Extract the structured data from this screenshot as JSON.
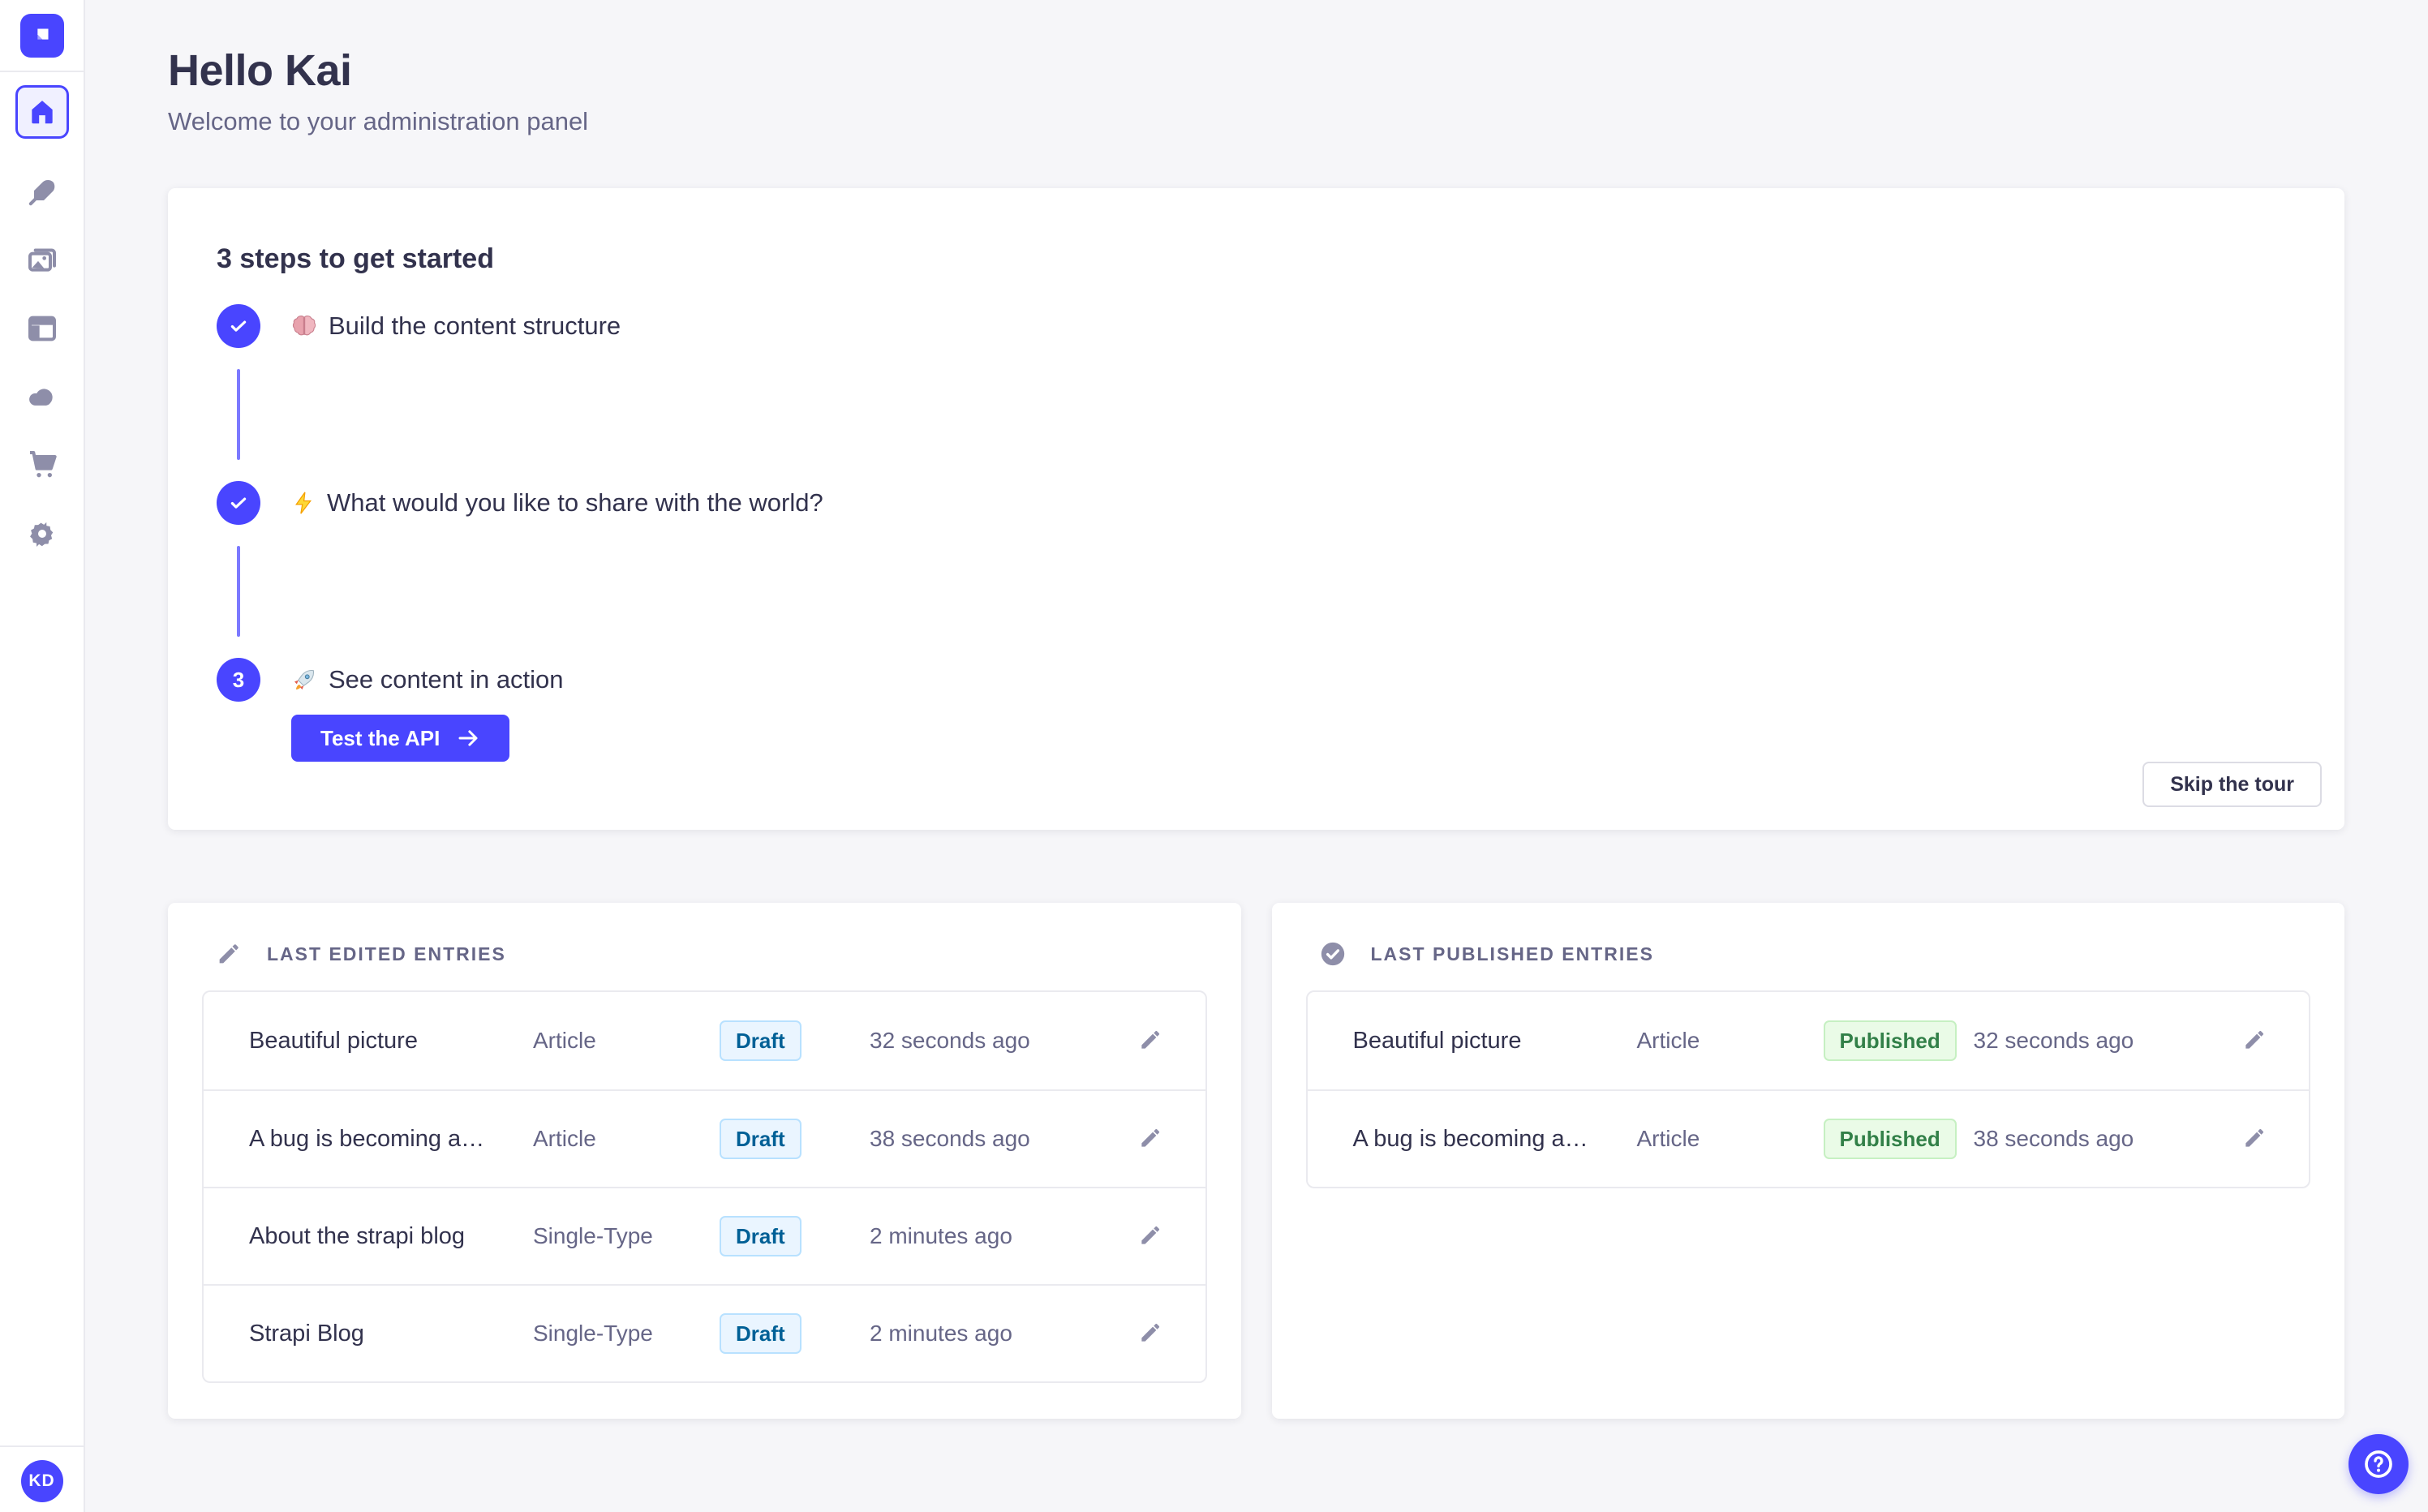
{
  "colors": {
    "accent": "#4945ff",
    "connector": "#7b79ff",
    "icon_gray": "#8e8ea9",
    "text": "#32324d",
    "muted": "#666687",
    "background": "#f6f6f9",
    "draft_bg": "#eaf5ff",
    "draft_border": "#b8e1ff",
    "draft_text": "#006096",
    "published_bg": "#eafbe7",
    "published_border": "#c6f0c2",
    "published_text": "#328048"
  },
  "sidebar": {
    "logo_icon": "strapi-logo",
    "items": [
      {
        "icon": "home-icon",
        "active": true
      },
      {
        "icon": "feather-icon",
        "active": false
      },
      {
        "icon": "images-icon",
        "active": false
      },
      {
        "icon": "layout-icon",
        "active": false
      },
      {
        "icon": "cloud-icon",
        "active": false
      },
      {
        "icon": "cart-icon",
        "active": false
      },
      {
        "icon": "gear-icon",
        "active": false
      }
    ],
    "avatar_initials": "KD"
  },
  "header": {
    "title": "Hello Kai",
    "subtitle": "Welcome to your administration panel"
  },
  "onboarding": {
    "title": "3 steps to get started",
    "steps": [
      {
        "emoji": "🧠",
        "label": "Build the content structure",
        "state": "done"
      },
      {
        "emoji": "⚡",
        "label": "What would you like to share with the world?",
        "state": "done"
      },
      {
        "emoji": "🚀",
        "label": "See content in action",
        "state": "current",
        "number": "3"
      }
    ],
    "cta_label": "Test the API",
    "skip_label": "Skip the tour"
  },
  "tables": {
    "edited": {
      "title": "LAST EDITED ENTRIES",
      "rows": [
        {
          "title": "Beautiful picture",
          "kind": "Article",
          "status": "Draft",
          "time": "32 seconds ago"
        },
        {
          "title": "A bug is becoming a…",
          "kind": "Article",
          "status": "Draft",
          "time": "38 seconds ago"
        },
        {
          "title": "About the strapi blog",
          "kind": "Single-Type",
          "status": "Draft",
          "time": "2 minutes ago"
        },
        {
          "title": "Strapi Blog",
          "kind": "Single-Type",
          "status": "Draft",
          "time": "2 minutes ago"
        }
      ]
    },
    "published": {
      "title": "LAST PUBLISHED ENTRIES",
      "rows": [
        {
          "title": "Beautiful picture",
          "kind": "Article",
          "status": "Published",
          "time": "32 seconds ago"
        },
        {
          "title": "A bug is becoming a…",
          "kind": "Article",
          "status": "Published",
          "time": "38 seconds ago"
        }
      ]
    }
  },
  "help": {
    "icon": "question-icon"
  }
}
